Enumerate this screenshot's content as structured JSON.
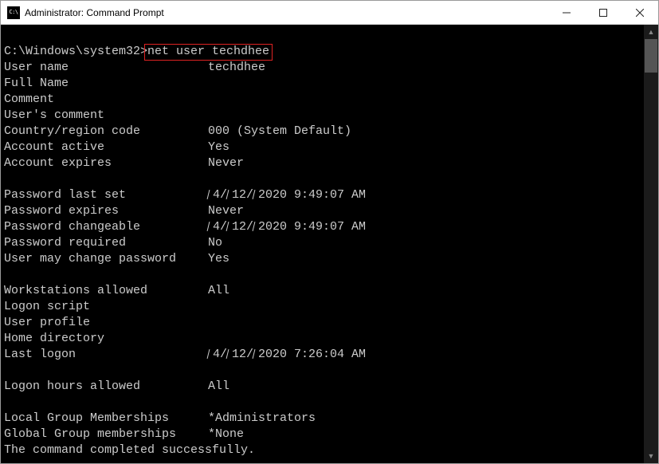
{
  "titlebar": {
    "title": "Administrator: Command Prompt"
  },
  "terminal": {
    "prompt": "C:\\Windows\\system32>",
    "command": "net user techdhee",
    "pairs": [
      {
        "label": "User name",
        "value": "techdhee"
      },
      {
        "label": "Full Name",
        "value": ""
      },
      {
        "label": "Comment",
        "value": ""
      },
      {
        "label": "User's comment",
        "value": ""
      },
      {
        "label": "Country/region code",
        "value": "000 (System Default)"
      },
      {
        "label": "Account active",
        "value": "Yes"
      },
      {
        "label": "Account expires",
        "value": "Never"
      },
      {
        "label": "",
        "value": ""
      },
      {
        "label": "Password last set",
        "value": "",
        "date": [
          "4/",
          "12/",
          "2020 9:49:07 AM"
        ]
      },
      {
        "label": "Password expires",
        "value": "Never"
      },
      {
        "label": "Password changeable",
        "value": "",
        "date": [
          "4/",
          "12/",
          "2020 9:49:07 AM"
        ]
      },
      {
        "label": "Password required",
        "value": "No"
      },
      {
        "label": "User may change password",
        "value": "Yes"
      },
      {
        "label": "",
        "value": ""
      },
      {
        "label": "Workstations allowed",
        "value": "All"
      },
      {
        "label": "Logon script",
        "value": ""
      },
      {
        "label": "User profile",
        "value": ""
      },
      {
        "label": "Home directory",
        "value": ""
      },
      {
        "label": "Last logon",
        "value": "",
        "date": [
          "4/",
          "12/",
          "2020 7:26:04 AM"
        ]
      },
      {
        "label": "",
        "value": ""
      },
      {
        "label": "Logon hours allowed",
        "value": "All"
      },
      {
        "label": "",
        "value": ""
      },
      {
        "label": "Local Group Memberships",
        "value": "*Administrators"
      },
      {
        "label": "Global Group memberships",
        "value": "*None"
      }
    ],
    "footer": "The command completed successfully.",
    "blank_after_prompt": ""
  }
}
